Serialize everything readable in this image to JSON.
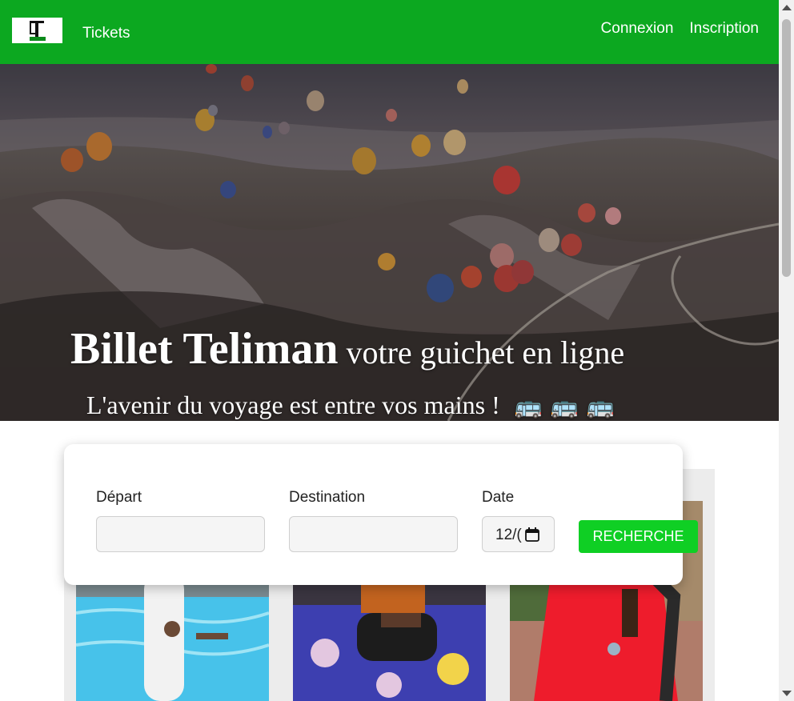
{
  "nav": {
    "brand": "Tickets",
    "logo_text": "BT",
    "links": [
      "Connexion",
      "Inscription"
    ]
  },
  "hero": {
    "title_bold": "Billet Teliman",
    "title_rest": " votre guichet en ligne",
    "subtitle": "L'avenir du voyage est entre vos mains !",
    "bus_emojis": [
      "🚌",
      "🚌",
      "🚌"
    ]
  },
  "search": {
    "depart_label": "Départ",
    "depart_value": "",
    "destination_label": "Destination",
    "destination_value": "",
    "date_label": "Date",
    "date_value": "12/(",
    "button_label": "RECHERCHE"
  },
  "colors": {
    "nav_bg": "#0ca820",
    "button_bg": "#0fcf24"
  }
}
